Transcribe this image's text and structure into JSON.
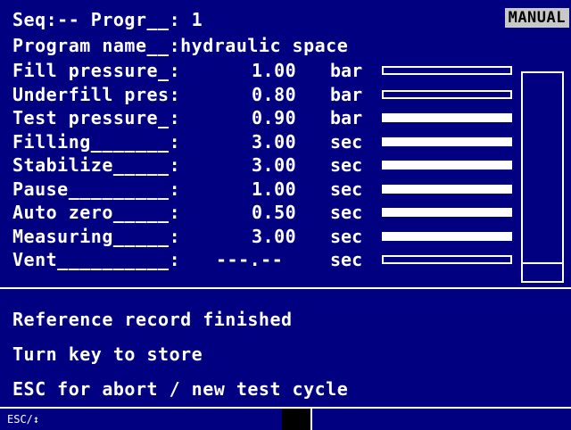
{
  "header": {
    "seq_line": "Seq:-- Progr__: 1",
    "mode": "MANUAL",
    "program_line": "Program name__:hydraulic space"
  },
  "params": [
    {
      "label": "Fill pressure_:",
      "value": "1.00",
      "unit": "bar",
      "level": 0.0
    },
    {
      "label": "Underfill pres:",
      "value": "0.80",
      "unit": "bar",
      "level": 0.0
    },
    {
      "label": "Test pressure_:",
      "value": "0.90",
      "unit": "bar",
      "level": 1.0
    },
    {
      "label": "Filling_______:",
      "value": "3.00",
      "unit": "sec",
      "level": 1.0
    },
    {
      "label": "Stabilize_____:",
      "value": "3.00",
      "unit": "sec",
      "level": 1.0
    },
    {
      "label": "Pause_________:",
      "value": "1.00",
      "unit": "sec",
      "level": 1.0
    },
    {
      "label": "Auto zero_____:",
      "value": "0.50",
      "unit": "sec",
      "level": 1.0
    },
    {
      "label": "Measuring_____:",
      "value": "3.00",
      "unit": "sec",
      "level": 1.0
    },
    {
      "label": "Vent__________:",
      "value": "---.--",
      "unit": "sec",
      "level": 0.0
    }
  ],
  "messages": [
    "Reference record finished",
    "Turn key to store",
    "ESC for abort / new test cycle"
  ],
  "status": {
    "left": "ESC/↕"
  },
  "colors": {
    "background": "#000080",
    "foreground": "#ffffff",
    "badge": "#c8c8c8"
  }
}
